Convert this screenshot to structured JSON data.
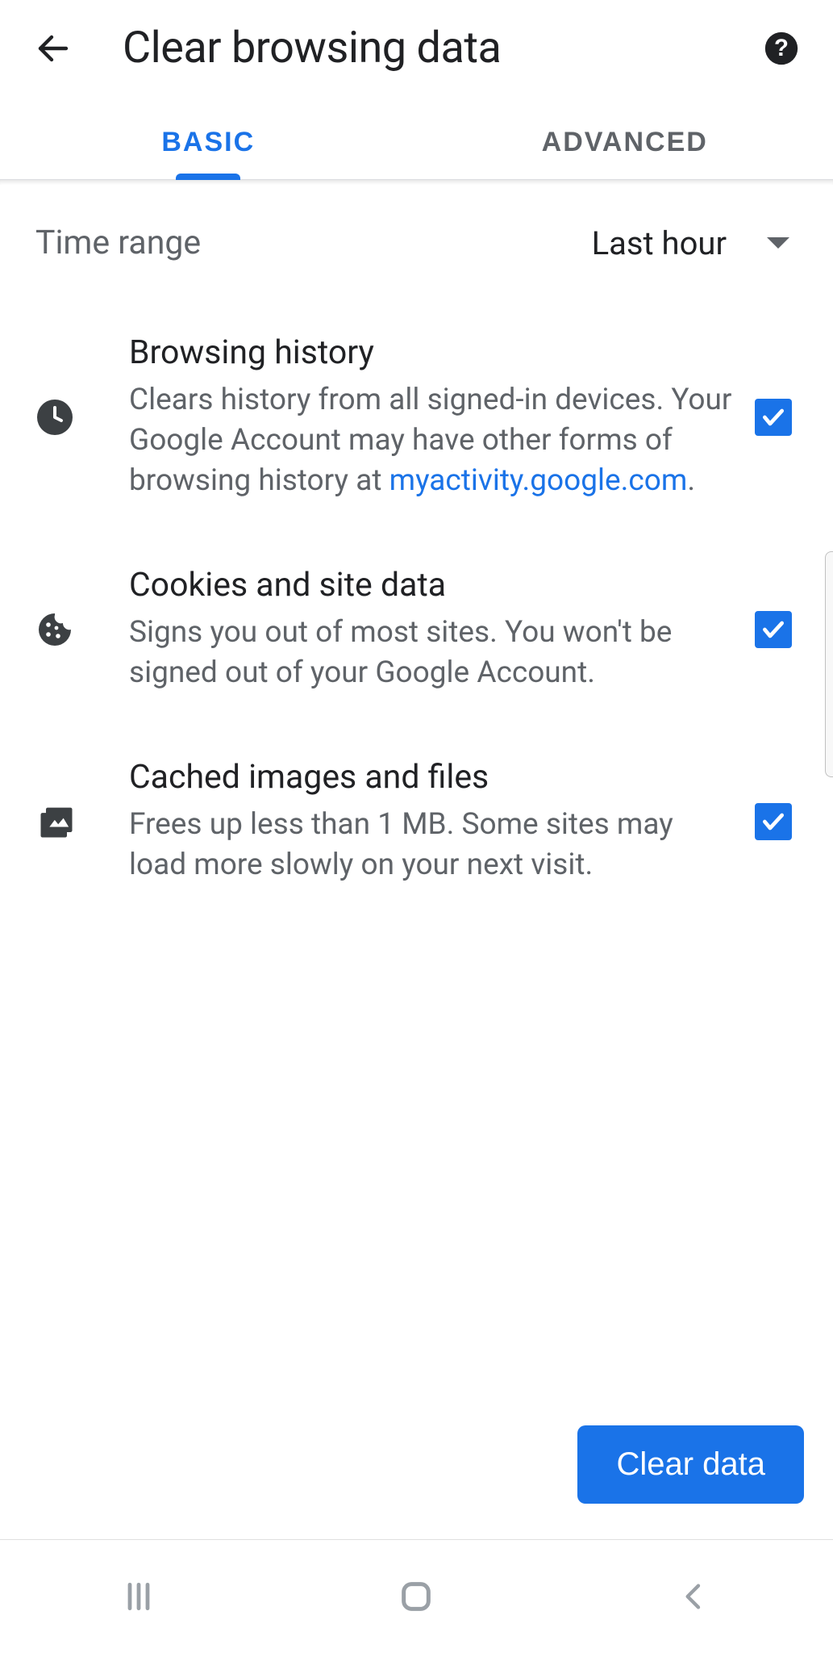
{
  "header": {
    "title": "Clear browsing data"
  },
  "tabs": {
    "basic": "BASIC",
    "advanced": "ADVANCED"
  },
  "time_range": {
    "label": "Time range",
    "value": "Last hour"
  },
  "options": [
    {
      "title": "Browsing history",
      "desc_pre": "Clears history from all signed-in devices. Your Google Account may have other forms of browsing history at ",
      "link": "myactivity.google.com",
      "desc_post": ".",
      "checked": true
    },
    {
      "title": "Cookies and site data",
      "desc": "Signs you out of most sites. You won't be signed out of your Google Account.",
      "checked": true
    },
    {
      "title": "Cached images and files",
      "desc": "Frees up less than 1 MB. Some sites may load more slowly on your next visit.",
      "checked": true
    }
  ],
  "clear_button": "Clear data"
}
